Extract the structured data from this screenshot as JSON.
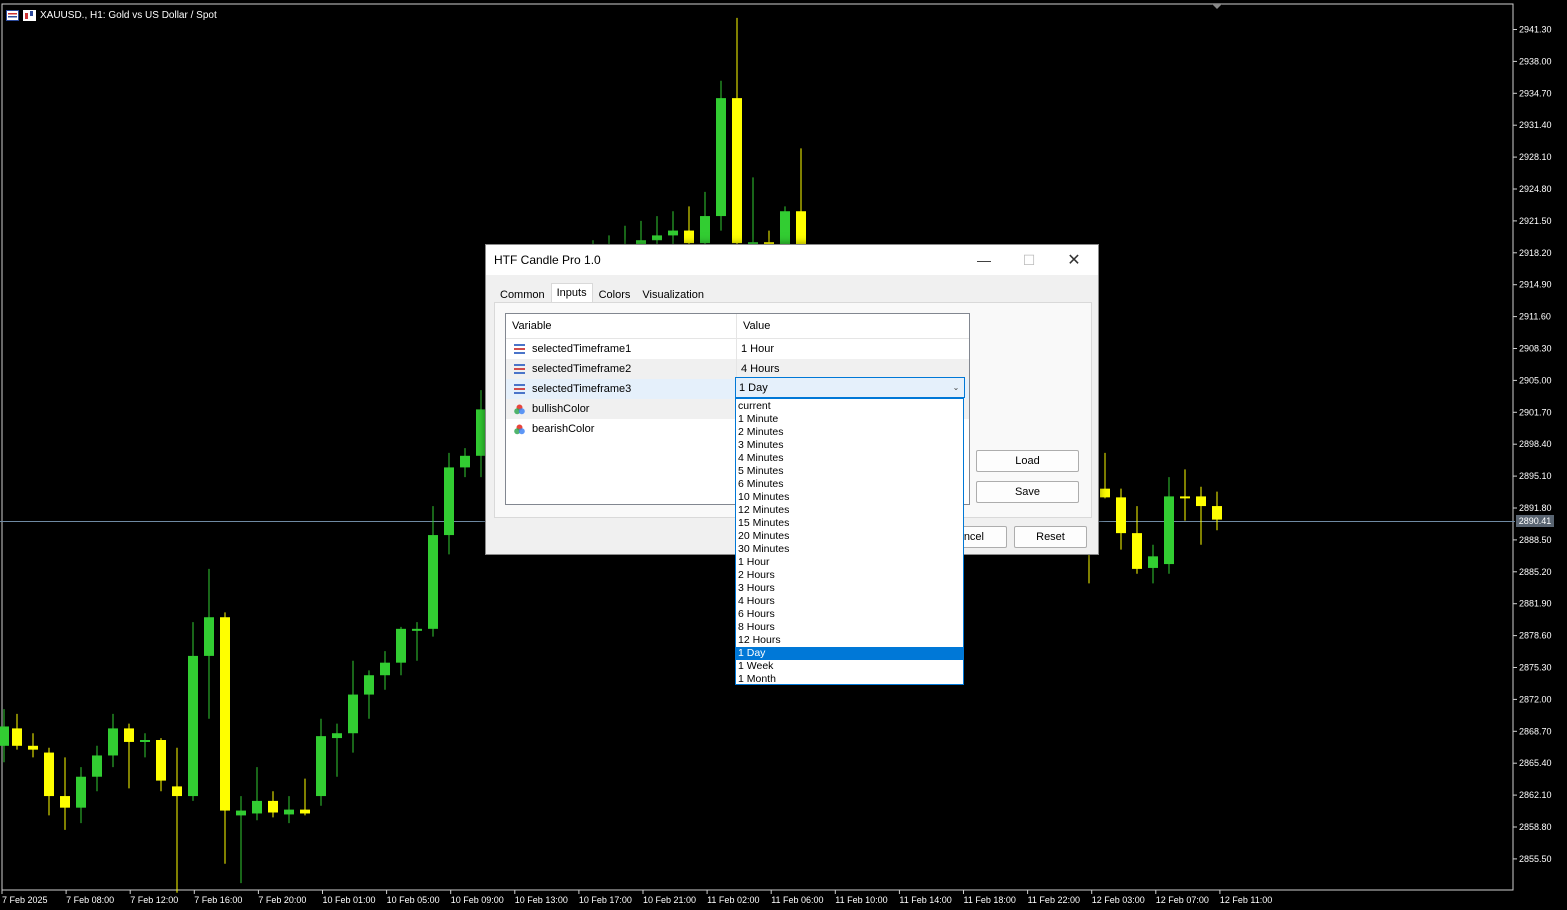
{
  "chart": {
    "title": "XAUUSD., H1:  Gold vs US Dollar / Spot",
    "current_price": "2890.41",
    "price_labels": [
      "2941.30",
      "2938.00",
      "2934.70",
      "2931.40",
      "2928.10",
      "2924.80",
      "2921.50",
      "2918.20",
      "2914.90",
      "2911.60",
      "2908.30",
      "2905.00",
      "2901.70",
      "2898.40",
      "2895.10",
      "2891.80",
      "2888.50",
      "2885.20",
      "2881.90",
      "2878.60",
      "2875.30",
      "2872.00",
      "2868.70",
      "2865.40",
      "2862.10",
      "2858.80",
      "2855.50"
    ],
    "time_labels": [
      "7 Feb 2025",
      "7 Feb 08:00",
      "7 Feb 12:00",
      "7 Feb 16:00",
      "7 Feb 20:00",
      "10 Feb 01:00",
      "10 Feb 05:00",
      "10 Feb 09:00",
      "10 Feb 13:00",
      "10 Feb 17:00",
      "10 Feb 21:00",
      "11 Feb 02:00",
      "11 Feb 06:00",
      "11 Feb 10:00",
      "11 Feb 14:00",
      "11 Feb 18:00",
      "11 Feb 22:00",
      "12 Feb 03:00",
      "12 Feb 07:00",
      "12 Feb 11:00"
    ],
    "bull_color": "#32cd32",
    "bear_color": "#ffff00"
  },
  "dialog": {
    "title": "HTF Candle Pro 1.0",
    "tabs": [
      "Common",
      "Inputs",
      "Colors",
      "Visualization"
    ],
    "active_tab": "Inputs",
    "columns": {
      "variable": "Variable",
      "value": "Value"
    },
    "rows": [
      {
        "name": "selectedTimeframe1",
        "value": "1 Hour",
        "icon": "enum-icon"
      },
      {
        "name": "selectedTimeframe2",
        "value": "4 Hours",
        "icon": "enum-icon"
      },
      {
        "name": "selectedTimeframe3",
        "value": "1 Day",
        "icon": "enum-icon"
      },
      {
        "name": "bullishColor",
        "value": "",
        "icon": "color-icon"
      },
      {
        "name": "bearishColor",
        "value": "",
        "icon": "color-icon"
      }
    ],
    "buttons": {
      "load": "Load",
      "save": "Save",
      "cancel": "ncel",
      "reset": "Reset"
    },
    "dropdown": {
      "selected": "1 Day",
      "options": [
        "current",
        "1 Minute",
        "2 Minutes",
        "3 Minutes",
        "4 Minutes",
        "5 Minutes",
        "6 Minutes",
        "10 Minutes",
        "12 Minutes",
        "15 Minutes",
        "20 Minutes",
        "30 Minutes",
        "1 Hour",
        "2 Hours",
        "3 Hours",
        "4 Hours",
        "6 Hours",
        "8 Hours",
        "12 Hours",
        "1 Day",
        "1 Week",
        "1 Month"
      ]
    }
  }
}
